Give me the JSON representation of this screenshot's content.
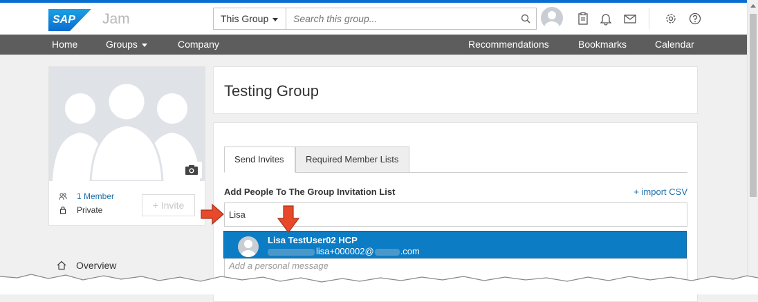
{
  "header": {
    "app_name": "Jam",
    "logo_text": "SAP",
    "scope_label": "This Group",
    "search_placeholder": "Search this group...",
    "icons": [
      "avatar",
      "clipboard-icon",
      "bell-icon",
      "mail-icon",
      "gear-icon",
      "help-icon"
    ]
  },
  "nav": {
    "home": "Home",
    "groups": "Groups",
    "company": "Company",
    "recommendations": "Recommendations",
    "bookmarks": "Bookmarks",
    "calendar": "Calendar"
  },
  "group_card": {
    "members": "1 Member",
    "privacy": "Private",
    "invite_label": "+ Invite"
  },
  "sidebar": {
    "overview": "Overview"
  },
  "main": {
    "title": "Testing Group",
    "tabs": [
      "Send Invites",
      "Required Member Lists"
    ],
    "active_tab": "Send Invites",
    "add_label": "Add People To The Group Invitation List",
    "import_csv": "+ import CSV",
    "people_input_value": "Lisa",
    "message_placeholder": "Add a personal message"
  },
  "suggestion": {
    "name": "Lisa TestUser02 HCP",
    "email_visible": "lisa+000002@",
    "email_suffix": ".com"
  },
  "colors": {
    "accent": "#0a6ed1",
    "nav_bg": "#5d5d5d",
    "highlight": "#0c7cc4",
    "arrow": "#e8492a",
    "link": "#1d6ea8"
  }
}
